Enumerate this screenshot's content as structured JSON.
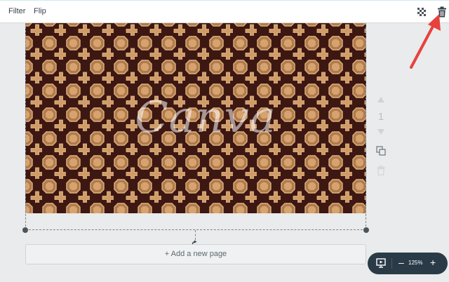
{
  "toolbar": {
    "filter_label": "Filter",
    "flip_label": "Flip",
    "transparency_icon": "transparency-icon",
    "trash_icon": "trash-icon"
  },
  "canvas": {
    "watermark_text": "Canva",
    "pattern": "octagon-and-cross wood parquet tile",
    "colors": {
      "wood_dark": "#3d1712",
      "tile_light": "#d6a36f",
      "tile_mid": "#b07b4c"
    }
  },
  "page_controls": {
    "page_number": "1",
    "icons": [
      "arrow-up-icon",
      "arrow-down-icon",
      "copy-page-icon",
      "delete-page-icon"
    ]
  },
  "add_page": {
    "label": "+ Add a new page"
  },
  "zoom": {
    "level": "125%",
    "minus_label": "–",
    "plus_label": "+",
    "present_icon": "present-icon"
  },
  "annotation": {
    "arrow_color": "#e8413d",
    "points_to": "trash-icon"
  }
}
